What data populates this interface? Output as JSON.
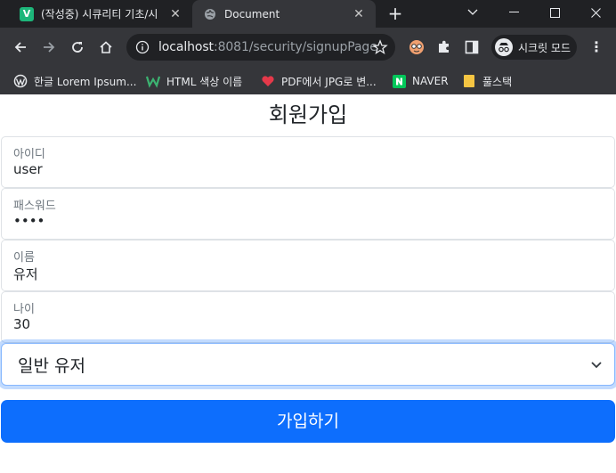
{
  "tabs": [
    {
      "title": "(작성중) 시큐리티 기초/시",
      "favicon": "v-icon"
    },
    {
      "title": "Document",
      "favicon": "globe-icon"
    }
  ],
  "toolbar": {
    "url_host": "localhost",
    "url_rest": ":8081/security/signupPage",
    "incognito_label": "시크릿 모드"
  },
  "bookmarks": [
    {
      "label": "한글 Lorem Ipsum...",
      "icon": "wordpress-icon"
    },
    {
      "label": "HTML 색상 이름",
      "icon": "w-logo-icon"
    },
    {
      "label": "PDF에서 JPG로 변...",
      "icon": "heart-icon"
    },
    {
      "label": "NAVER",
      "icon": "naver-icon"
    },
    {
      "label": "풀스택",
      "icon": "folder-icon"
    }
  ],
  "form": {
    "heading": "회원가입",
    "fields": [
      {
        "label": "아이디",
        "value": "user"
      },
      {
        "label": "패스워드",
        "value": "••••"
      },
      {
        "label": "이름",
        "value": "유저"
      },
      {
        "label": "나이",
        "value": "30"
      }
    ],
    "select_value": "일반 유저",
    "submit_label": "가입하기"
  },
  "colors": {
    "primary": "#0d6efd",
    "chrome_dark": "#202124",
    "chrome_toolbar": "#35363a"
  }
}
